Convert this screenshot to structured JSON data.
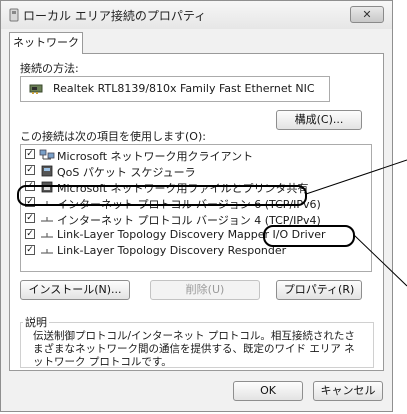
{
  "window": {
    "title": "ローカル エリア接続のプロパティ",
    "close_label": "✕"
  },
  "tabs": [
    {
      "label": "ネットワーク"
    }
  ],
  "connect_using": {
    "label": "接続の方法:",
    "adapter_name": "Realtek RTL8139/810x Family Fast Ethernet NIC",
    "configure_button": "構成(C)..."
  },
  "items_section": {
    "label": "この接続は次の項目を使用します(O):",
    "items": [
      {
        "label": "Microsoft ネットワーク用クライアント",
        "checked": true,
        "icon": "network-client-icon"
      },
      {
        "label": "QoS パケット スケジューラ",
        "checked": true,
        "icon": "qos-icon"
      },
      {
        "label": "Microsoft ネットワーク用ファイルとプリンタ共有",
        "checked": true,
        "icon": "file-printer-share-icon"
      },
      {
        "label": "インターネット プロトコル バージョン 6 (TCP/IPv6)",
        "checked": true,
        "icon": "protocol-icon"
      },
      {
        "label": "インターネット プロトコル バージョン 4 (TCP/IPv4)",
        "checked": true,
        "icon": "protocol-icon",
        "selected": true
      },
      {
        "label": "Link-Layer Topology Discovery Mapper I/O Driver",
        "checked": true,
        "icon": "protocol-icon"
      },
      {
        "label": "Link-Layer Topology Discovery Responder",
        "checked": true,
        "icon": "protocol-icon"
      }
    ]
  },
  "actions": {
    "install": "インストール(N)...",
    "uninstall": "削除(U)",
    "properties": "プロパティ(R)"
  },
  "description": {
    "label": "説明",
    "text": "伝送制御プロトコル/インターネット プロトコル。相互接続されたさまざまなネットワーク間の通信を提供する、既定のワイド エリア ネットワーク プロトコルです。"
  },
  "footer": {
    "ok": "OK",
    "cancel": "キャンセル"
  }
}
